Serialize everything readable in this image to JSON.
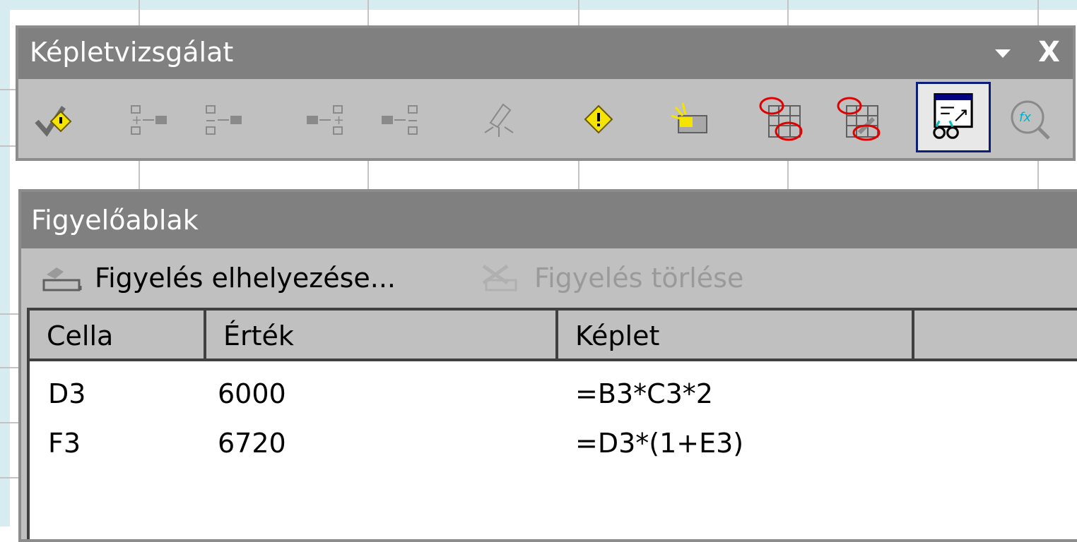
{
  "colors": {
    "title_bar": "#808080",
    "window_face": "#c0c0c0",
    "selection_border": "#0a1e7a",
    "backdrop": "#d7ecf0"
  },
  "formula_auditing_toolbar": {
    "title": "Képletvizsgálat",
    "close_glyph": "X",
    "icons": [
      "error-checking-icon",
      "trace-precedents-icon",
      "remove-precedent-arrows-icon",
      "trace-dependents-icon",
      "remove-dependent-arrows-icon",
      "remove-all-arrows-icon",
      "trace-error-icon",
      "new-comment-icon",
      "circle-invalid-data-icon",
      "clear-validation-circles-icon",
      "show-watch-window-icon",
      "evaluate-formula-icon"
    ],
    "selected_icon": "show-watch-window-icon"
  },
  "watch_window": {
    "title": "Figyelőablak",
    "add_watch_label": "Figyelés elhelyezése...",
    "delete_watch_label": "Figyelés törlése",
    "columns": [
      "Cella",
      "Érték",
      "Képlet",
      ""
    ],
    "rows": [
      {
        "cell": "D3",
        "value": "6000",
        "formula": "=B3*C3*2"
      },
      {
        "cell": "F3",
        "value": "6720",
        "formula": "=D3*(1+E3)"
      }
    ]
  }
}
